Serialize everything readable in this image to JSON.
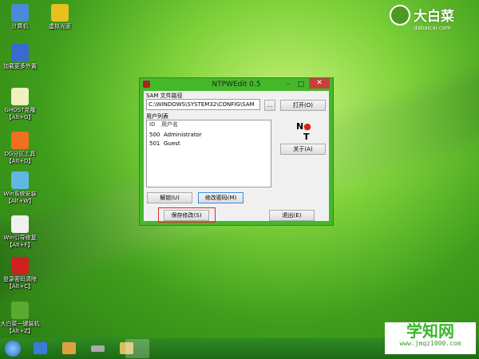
{
  "desktop": {
    "icons": [
      {
        "label": "计算机",
        "icon": "computer-icon",
        "color": "#4a8ad8"
      },
      {
        "label": "虚拟光驱",
        "icon": "disc-icon",
        "color": "#e8c020"
      },
      {
        "label": "加载更多外置",
        "icon": "grid-icon",
        "color": "#3a6ad0"
      },
      {
        "label": "GHOST克隆",
        "label2": "【Alt+G】",
        "icon": "ghost-icon",
        "color": "#f0f0c0"
      },
      {
        "label": "DG分区工具",
        "label2": "【Alt+D】",
        "icon": "partition-icon",
        "color": "#f07020"
      },
      {
        "label": "Win系统安装",
        "label2": "【Alt+W】",
        "icon": "install-icon",
        "color": "#60b8e0"
      },
      {
        "label": "Win引导修复",
        "label2": "【Alt+F】",
        "icon": "repair-icon",
        "color": "#f0f0f0"
      },
      {
        "label": "登录密码清除",
        "label2": "【Alt+C】",
        "icon": "ntpwedit-icon",
        "color": "#d02020"
      },
      {
        "label": "大白菜一键装机",
        "label2": "【Alt+Z】",
        "icon": "dabaicai-icon",
        "color": "#5aaa30"
      }
    ]
  },
  "logo": {
    "title": "大白菜",
    "sub": "dabaicai.com"
  },
  "window": {
    "title": "NTPWEdit 0.5",
    "minimize": "–",
    "maximize": "□",
    "close": "✕",
    "sam_label": "SAM 文件路径",
    "sam_path": "C:\\WINDOWS\\SYSTEM32\\CONFIG\\SAM",
    "browse": "...",
    "open": "打开(O)",
    "list_label": "用户列表",
    "columns": [
      "ID",
      "用户名"
    ],
    "users": [
      {
        "id": "500",
        "name": "Administrator"
      },
      {
        "id": "501",
        "name": "Guest"
      }
    ],
    "about": "关于(A)",
    "unlock": "解锁(U)",
    "change_pwd": "修改密码(M)",
    "save": "保存修改(S)",
    "exit": "退出(E)"
  },
  "watermark": {
    "title": "学知网",
    "url": "www.jmqz1000.com"
  }
}
